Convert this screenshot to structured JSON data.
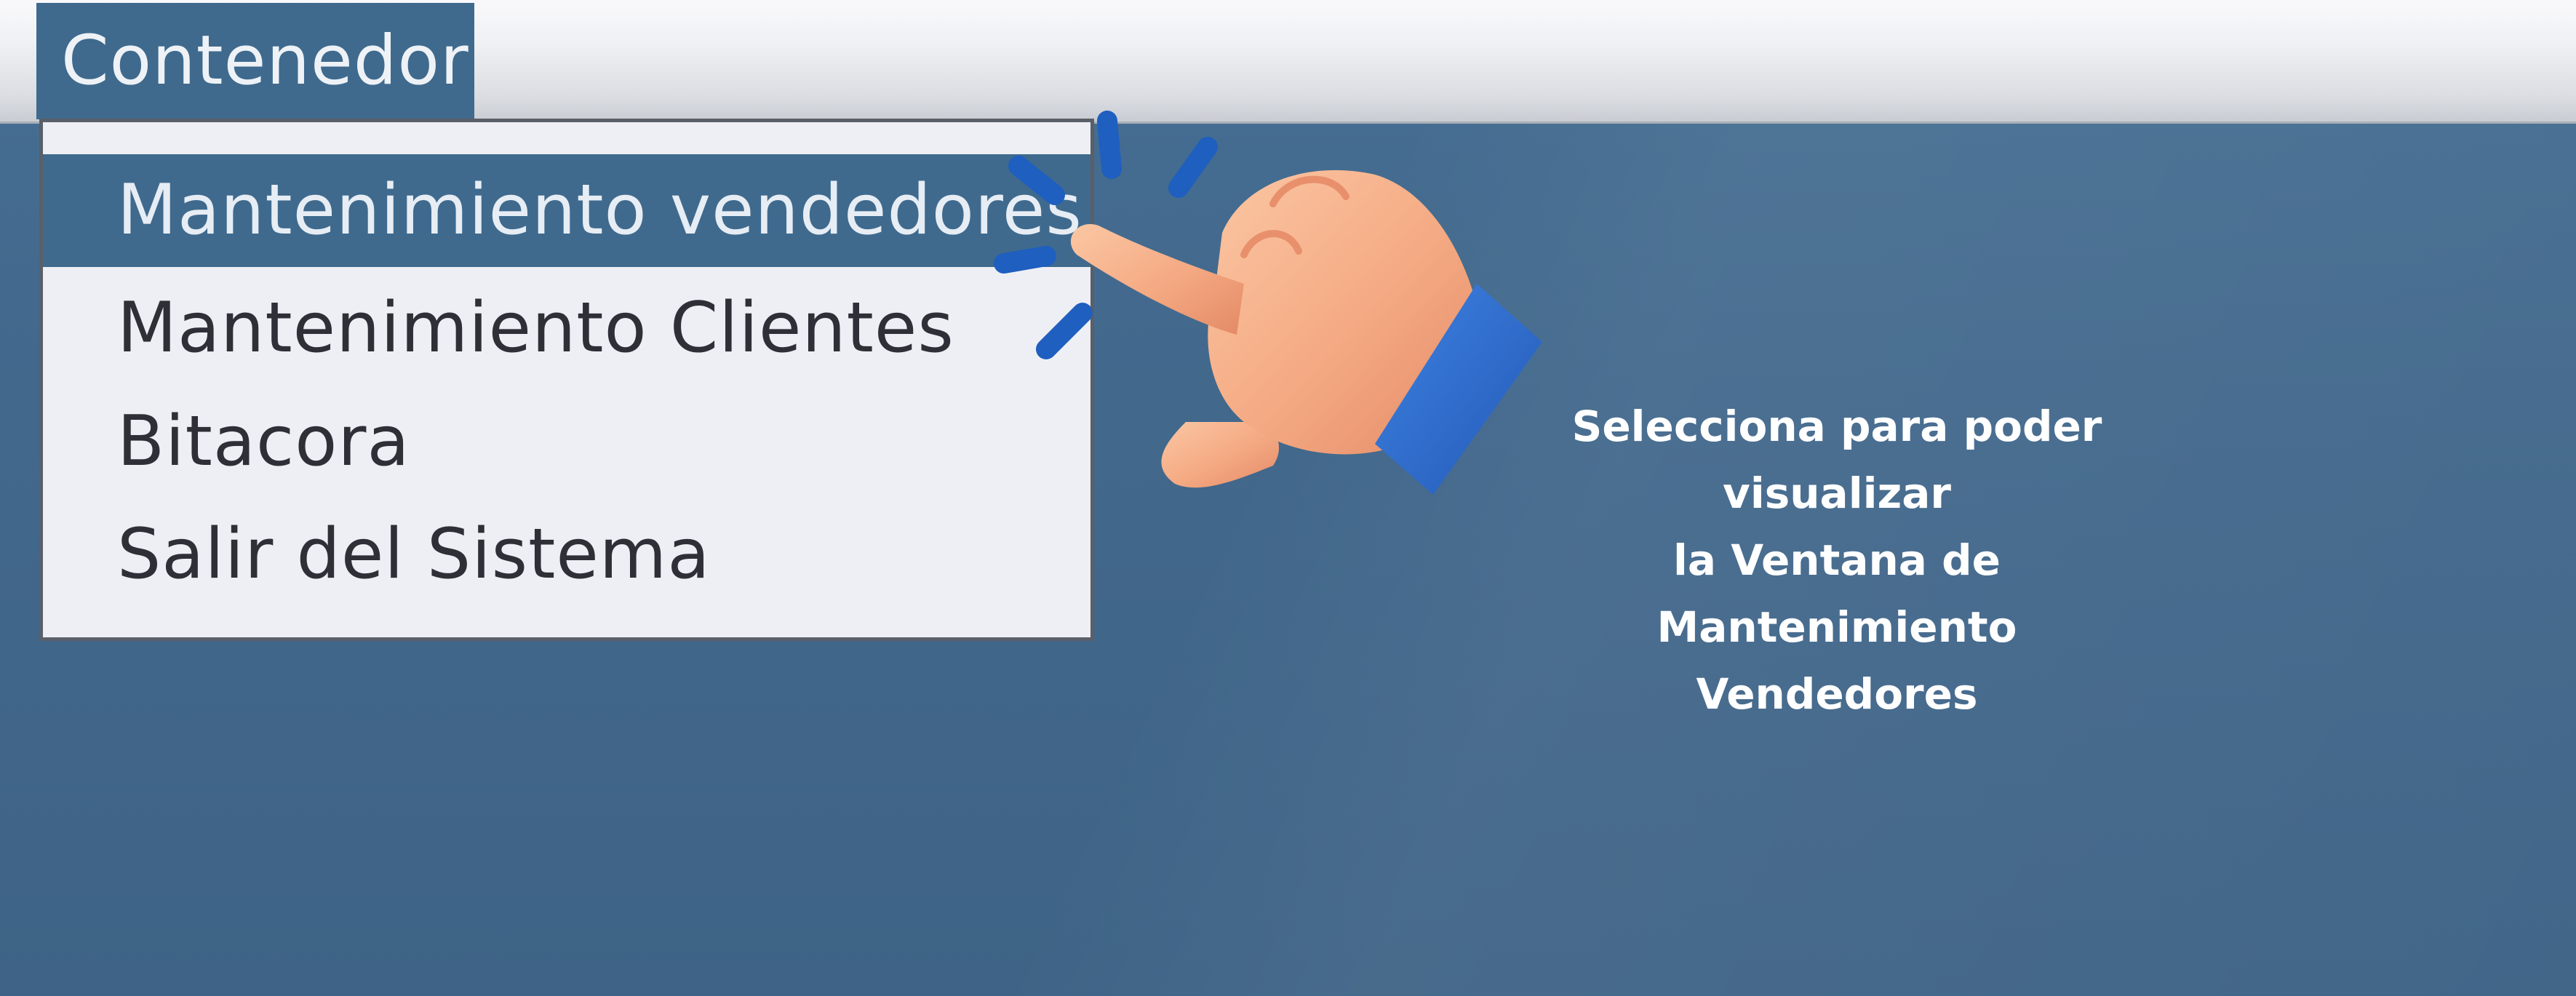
{
  "menubar": {
    "menu_label": "Contenedor"
  },
  "dropdown": {
    "items": [
      {
        "label": "Mantenimiento vendedores",
        "selected": true
      },
      {
        "label": "Mantenimiento Clientes",
        "selected": false
      },
      {
        "label": "Bitacora",
        "selected": false
      },
      {
        "label": "Salir del Sistema",
        "selected": false
      }
    ]
  },
  "annotation": {
    "icon": "pointing-hand-icon",
    "lines": [
      "Selecciona para poder visualizar",
      "la Ventana de Mantenimiento",
      "Vendedores"
    ]
  },
  "colors": {
    "desktop_background": "#42688c",
    "menu_highlight": "#3f6a8e",
    "dropdown_background": "#eeeff4",
    "hand_skin": "#f4a982",
    "cuff_blue": "#2f6fcf",
    "accent_dash_blue": "#1e5fbf",
    "hint_text": "#ffffff"
  }
}
